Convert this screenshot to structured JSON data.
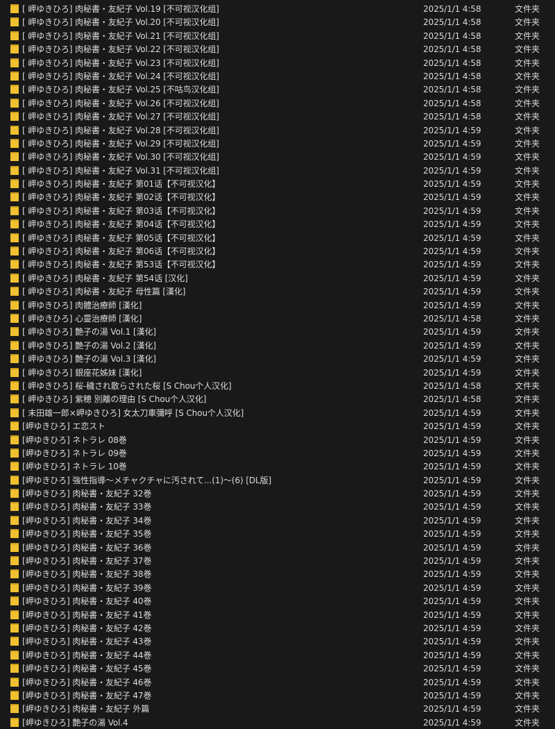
{
  "colors": {
    "background": "#191919",
    "text": "#dcdcdc",
    "folder_icon": "#f0c030",
    "folder_icon_dark": "#c9a020"
  },
  "icon": "folder-icon",
  "files": [
    {
      "name": "[ 岬ゆきひろ] 肉秘書・友紀子 Vol.19 [不可视汉化组]",
      "date": "2025/1/1 4:58",
      "type": "文件夹"
    },
    {
      "name": "[ 岬ゆきひろ] 肉秘書・友紀子 Vol.20 [不可视汉化组]",
      "date": "2025/1/1 4:58",
      "type": "文件夹"
    },
    {
      "name": "[ 岬ゆきひろ] 肉秘書・友紀子 Vol.21 [不可视汉化组]",
      "date": "2025/1/1 4:58",
      "type": "文件夹"
    },
    {
      "name": "[ 岬ゆきひろ] 肉秘書・友紀子 Vol.22 [不可视汉化组]",
      "date": "2025/1/1 4:58",
      "type": "文件夹"
    },
    {
      "name": "[ 岬ゆきひろ] 肉秘書・友紀子 Vol.23 [不可视汉化组]",
      "date": "2025/1/1 4:58",
      "type": "文件夹"
    },
    {
      "name": "[ 岬ゆきひろ] 肉秘書・友紀子 Vol.24 [不可视汉化组]",
      "date": "2025/1/1 4:58",
      "type": "文件夹"
    },
    {
      "name": "[ 岬ゆきひろ] 肉秘書・友紀子 Vol.25 [不咕鸟汉化组]",
      "date": "2025/1/1 4:58",
      "type": "文件夹"
    },
    {
      "name": "[ 岬ゆきひろ] 肉秘書・友紀子 Vol.26 [不可视汉化组]",
      "date": "2025/1/1 4:58",
      "type": "文件夹"
    },
    {
      "name": "[ 岬ゆきひろ] 肉秘書・友紀子 Vol.27 [不可视汉化组]",
      "date": "2025/1/1 4:58",
      "type": "文件夹"
    },
    {
      "name": "[ 岬ゆきひろ] 肉秘書・友紀子 Vol.28 [不可视汉化组]",
      "date": "2025/1/1 4:59",
      "type": "文件夹"
    },
    {
      "name": "[ 岬ゆきひろ] 肉秘書・友紀子 Vol.29 [不可视汉化组]",
      "date": "2025/1/1 4:59",
      "type": "文件夹"
    },
    {
      "name": "[ 岬ゆきひろ] 肉秘書・友紀子 Vol.30 [不可视汉化组]",
      "date": "2025/1/1 4:59",
      "type": "文件夹"
    },
    {
      "name": "[ 岬ゆきひろ] 肉秘書・友紀子 Vol.31 [不可视汉化组]",
      "date": "2025/1/1 4:59",
      "type": "文件夹"
    },
    {
      "name": "[ 岬ゆきひろ] 肉秘書・友紀子 第01话【不可视汉化】",
      "date": "2025/1/1 4:59",
      "type": "文件夹"
    },
    {
      "name": "[ 岬ゆきひろ] 肉秘書・友紀子 第02话【不可视汉化】",
      "date": "2025/1/1 4:59",
      "type": "文件夹"
    },
    {
      "name": "[ 岬ゆきひろ] 肉秘書・友紀子 第03话【不可视汉化】",
      "date": "2025/1/1 4:59",
      "type": "文件夹"
    },
    {
      "name": "[ 岬ゆきひろ] 肉秘書・友紀子 第04话【不可视汉化】",
      "date": "2025/1/1 4:59",
      "type": "文件夹"
    },
    {
      "name": "[ 岬ゆきひろ] 肉秘書・友紀子 第05话【不可视汉化】",
      "date": "2025/1/1 4:59",
      "type": "文件夹"
    },
    {
      "name": "[ 岬ゆきひろ] 肉秘書・友紀子 第06话【不可视汉化】",
      "date": "2025/1/1 4:59",
      "type": "文件夹"
    },
    {
      "name": "[ 岬ゆきひろ] 肉秘書・友紀子 第53话【不可视汉化】",
      "date": "2025/1/1 4:59",
      "type": "文件夹"
    },
    {
      "name": "[ 岬ゆきひろ] 肉秘書・友紀子 第54话 [汉化]",
      "date": "2025/1/1 4:59",
      "type": "文件夹"
    },
    {
      "name": "[ 岬ゆきひろ] 肉秘書・友紀子 母性篇 [漢化]",
      "date": "2025/1/1 4:59",
      "type": "文件夹"
    },
    {
      "name": "[ 岬ゆきひろ] 肉體治療師 [漢化]",
      "date": "2025/1/1 4:59",
      "type": "文件夹"
    },
    {
      "name": "[ 岬ゆきひろ] 心靈治療師 [漢化]",
      "date": "2025/1/1 4:58",
      "type": "文件夹"
    },
    {
      "name": "[ 岬ゆきひろ] 艶子の湯 Vol.1 [漢化]",
      "date": "2025/1/1 4:59",
      "type": "文件夹"
    },
    {
      "name": "[ 岬ゆきひろ] 艶子の湯 Vol.2 [漢化]",
      "date": "2025/1/1 4:59",
      "type": "文件夹"
    },
    {
      "name": "[ 岬ゆきひろ] 艶子の湯 Vol.3 [漢化]",
      "date": "2025/1/1 4:59",
      "type": "文件夹"
    },
    {
      "name": "[ 岬ゆきひろ] 銀座花姊妹 [漢化]",
      "date": "2025/1/1 4:59",
      "type": "文件夹"
    },
    {
      "name": "[ 岬ゆきひろ] 桜-穢され散らされた桜 [S Chou个人汉化]",
      "date": "2025/1/1 4:58",
      "type": "文件夹"
    },
    {
      "name": "[ 岬ゆきひろ] 紫穂 別離の理由 [S Chou个人汉化]",
      "date": "2025/1/1 4:58",
      "type": "文件夹"
    },
    {
      "name": "[ 末田雄一郎×岬ゆきひろ] 女太刀車彌呼 [S Chou个人汉化]",
      "date": "2025/1/1 4:59",
      "type": "文件夹"
    },
    {
      "name": "[岬ゆきひろ] エ恋スト",
      "date": "2025/1/1 4:59",
      "type": "文件夹"
    },
    {
      "name": "[岬ゆきひろ] ネトラレ 08巻",
      "date": "2025/1/1 4:59",
      "type": "文件夹"
    },
    {
      "name": "[岬ゆきひろ] ネトラレ 09巻",
      "date": "2025/1/1 4:59",
      "type": "文件夹"
    },
    {
      "name": "[岬ゆきひろ] ネトラレ 10巻",
      "date": "2025/1/1 4:59",
      "type": "文件夹"
    },
    {
      "name": "[岬ゆきひろ] 強性指導～メチャクチャに汚されて...(1)～(6) [DL版]",
      "date": "2025/1/1 4:59",
      "type": "文件夹"
    },
    {
      "name": "[岬ゆきひろ] 肉秘書・友紀子 32巻",
      "date": "2025/1/1 4:59",
      "type": "文件夹"
    },
    {
      "name": "[岬ゆきひろ] 肉秘書・友紀子 33巻",
      "date": "2025/1/1 4:59",
      "type": "文件夹"
    },
    {
      "name": "[岬ゆきひろ] 肉秘書・友紀子 34巻",
      "date": "2025/1/1 4:59",
      "type": "文件夹"
    },
    {
      "name": "[岬ゆきひろ] 肉秘書・友紀子 35巻",
      "date": "2025/1/1 4:59",
      "type": "文件夹"
    },
    {
      "name": "[岬ゆきひろ] 肉秘書・友紀子 36巻",
      "date": "2025/1/1 4:59",
      "type": "文件夹"
    },
    {
      "name": "[岬ゆきひろ] 肉秘書・友紀子 37巻",
      "date": "2025/1/1 4:59",
      "type": "文件夹"
    },
    {
      "name": "[岬ゆきひろ] 肉秘書・友紀子 38巻",
      "date": "2025/1/1 4:59",
      "type": "文件夹"
    },
    {
      "name": "[岬ゆきひろ] 肉秘書・友紀子 39巻",
      "date": "2025/1/1 4:59",
      "type": "文件夹"
    },
    {
      "name": "[岬ゆきひろ] 肉秘書・友紀子 40巻",
      "date": "2025/1/1 4:59",
      "type": "文件夹"
    },
    {
      "name": "[岬ゆきひろ] 肉秘書・友紀子 41巻",
      "date": "2025/1/1 4:59",
      "type": "文件夹"
    },
    {
      "name": "[岬ゆきひろ] 肉秘書・友紀子 42巻",
      "date": "2025/1/1 4:59",
      "type": "文件夹"
    },
    {
      "name": "[岬ゆきひろ] 肉秘書・友紀子 43巻",
      "date": "2025/1/1 4:59",
      "type": "文件夹"
    },
    {
      "name": "[岬ゆきひろ] 肉秘書・友紀子 44巻",
      "date": "2025/1/1 4:59",
      "type": "文件夹"
    },
    {
      "name": "[岬ゆきひろ] 肉秘書・友紀子 45巻",
      "date": "2025/1/1 4:59",
      "type": "文件夹"
    },
    {
      "name": "[岬ゆきひろ] 肉秘書・友紀子 46巻",
      "date": "2025/1/1 4:59",
      "type": "文件夹"
    },
    {
      "name": "[岬ゆきひろ] 肉秘書・友紀子 47巻",
      "date": "2025/1/1 4:59",
      "type": "文件夹"
    },
    {
      "name": "[岬ゆきひろ] 肉秘書・友紀子 外篇",
      "date": "2025/1/1 4:59",
      "type": "文件夹"
    },
    {
      "name": "[岬ゆきひろ] 艶子の湯 Vol.4",
      "date": "2025/1/1 4:59",
      "type": "文件夹"
    }
  ]
}
